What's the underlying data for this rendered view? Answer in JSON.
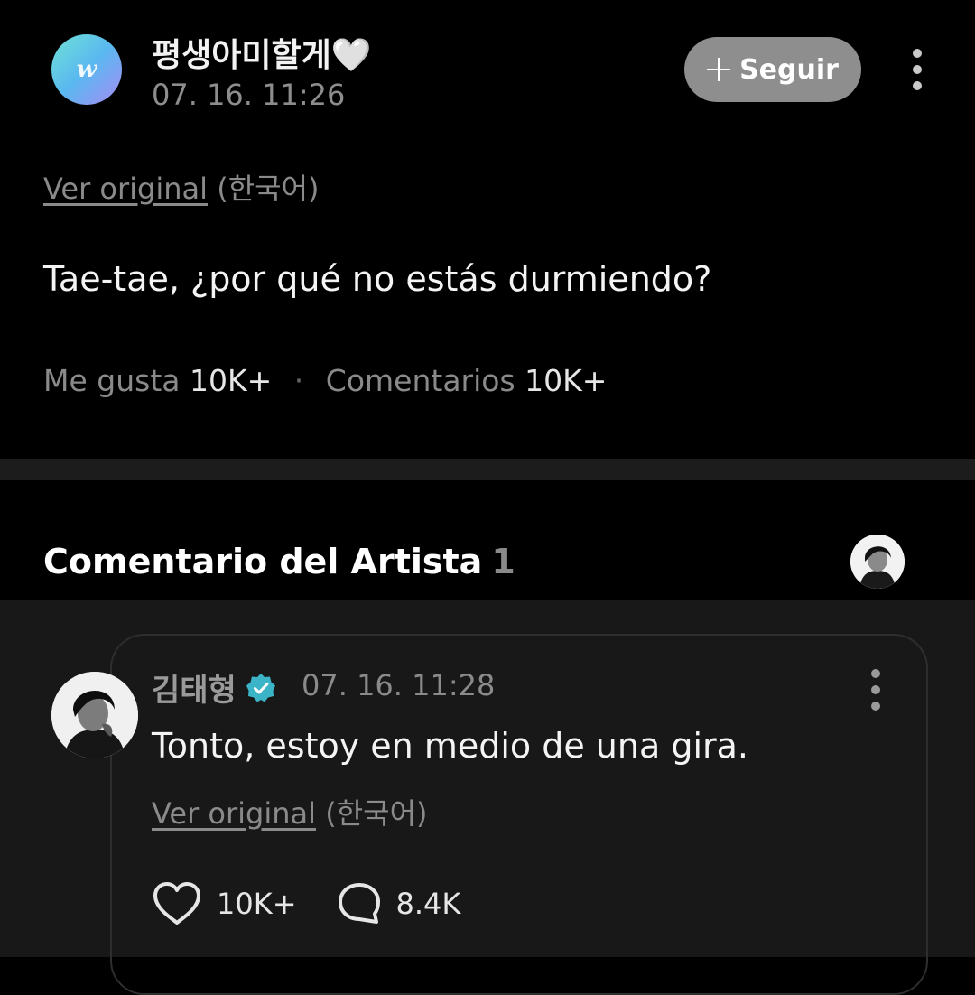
{
  "post": {
    "author_name": "평생아미할게🤍",
    "avatar_letter": "w",
    "time": "07. 16. 11:26",
    "follow_label": "Seguir",
    "translate_link": "Ver original",
    "translate_lang": "(한국어)",
    "body": "Tae-tae, ¿por qué no estás durmiendo?",
    "likes_label": "Me gusta",
    "likes_count": "10K+",
    "separator": "·",
    "comments_label": "Comentarios",
    "comments_count": "10K+"
  },
  "artist_section": {
    "title": "Comentario del Artista",
    "count": "1"
  },
  "artist_comment": {
    "author": "김태형",
    "time": "07. 16. 11:28",
    "body": "Tonto, estoy en medio de una gira.",
    "translate_link": "Ver original",
    "translate_lang": "(한국어)",
    "likes": "10K+",
    "replies": "8.4K"
  },
  "colors": {
    "background": "#000000",
    "comment_area": "#181818",
    "follow_button": "#8e8e8e",
    "verified_badge": "#3cb4c8",
    "secondary_text": "#8a8a8a"
  }
}
